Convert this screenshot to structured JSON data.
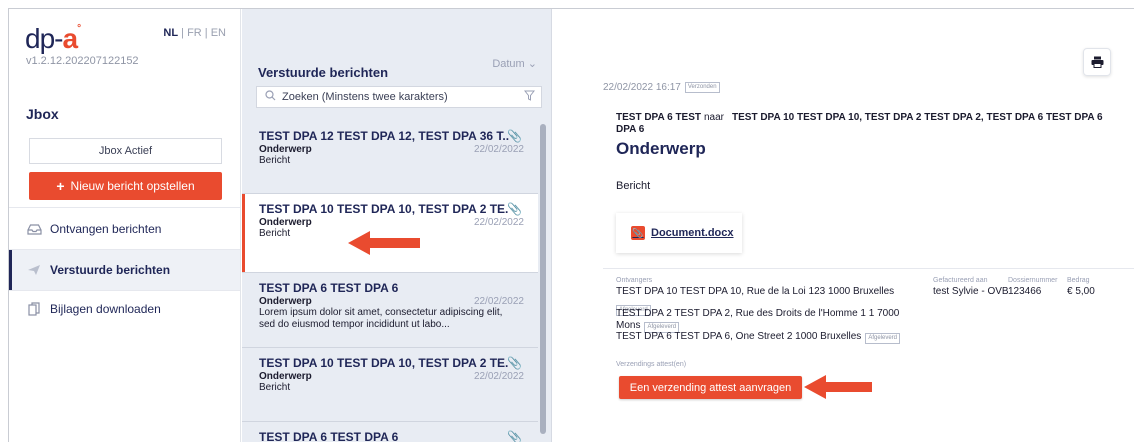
{
  "app": {
    "logo_text": "dp-a",
    "version": "v1.2.12.202207122152",
    "languages": [
      "NL",
      "FR",
      "EN"
    ],
    "active_language": "NL",
    "lang_sep": "|"
  },
  "sidebar": {
    "section_title": "Jbox",
    "jbox_status": "Jbox Actief",
    "new_message_label": "Nieuw bericht opstellen",
    "items": [
      {
        "label": "Ontvangen berichten",
        "icon": "inbox-icon",
        "active": false
      },
      {
        "label": "Verstuurde berichten",
        "icon": "send-icon",
        "active": true
      },
      {
        "label": "Bijlagen downloaden",
        "icon": "copy-icon",
        "active": false
      }
    ]
  },
  "list": {
    "title": "Verstuurde berichten",
    "sort_label": "Datum",
    "search_placeholder": "Zoeken (Minstens twee karakters)",
    "messages": [
      {
        "to": "TEST DPA 12 TEST DPA 12, TEST DPA 36 T...",
        "subject": "Onderwerp",
        "date": "22/02/2022",
        "body": "Bericht",
        "attachment": true,
        "selected": false
      },
      {
        "to": "TEST DPA 10 TEST DPA 10, TEST DPA 2 TE...",
        "subject": "Onderwerp",
        "date": "22/02/2022",
        "body": "Bericht",
        "attachment": true,
        "selected": true
      },
      {
        "to": "TEST DPA 6 TEST DPA 6",
        "subject": "Onderwerp",
        "date": "22/02/2022",
        "body": "Lorem ipsum dolor sit amet, consectetur adipiscing elit, sed do eiusmod tempor incididunt ut labo...",
        "attachment": false,
        "selected": false
      },
      {
        "to": "TEST DPA 10 TEST DPA 10, TEST DPA 2 TE...",
        "subject": "Onderwerp",
        "date": "22/02/2022",
        "body": "Bericht",
        "attachment": true,
        "selected": false
      },
      {
        "to": "TEST DPA 6 TEST DPA 6",
        "subject": "",
        "date": "",
        "body": "",
        "attachment": true,
        "selected": false
      }
    ]
  },
  "detail": {
    "datetime": "22/02/2022 16:17",
    "sent_badge": "Verzonden",
    "from": "TEST DPA 6 TEST DPA 6",
    "naar": "naar",
    "recipients": "TEST DPA 10 TEST DPA 10, TEST DPA 2 TEST DPA 2, TEST DPA 6 TEST DPA 6",
    "subject": "Onderwerp",
    "body": "Bericht",
    "attachment_name": "Document.docx",
    "columns": {
      "recipients": "Ontvangers",
      "invoiced_to": "Gefactureerd aan",
      "file_number": "Dossiernummer",
      "amount": "Bedrag"
    },
    "receivers": [
      {
        "name": "TEST DPA 10 TEST DPA 10",
        "address": ", Rue de la Loi 123 1000 Bruxelles",
        "status": "Afgeleverd"
      },
      {
        "name": "TEST DPA 2 TEST DPA 2",
        "address": ", Rue des Droits de l'Homme 1 1 7000",
        "address2": "Mons",
        "status": "Afgeleverd"
      },
      {
        "name": "TEST DPA 6 TEST DPA 6",
        "address": ", One Street 2 1000 Bruxelles",
        "status": "Afgeleverd"
      }
    ],
    "invoiced_to": "test Sylvie - OVB",
    "file_number": "123466",
    "amount": "€ 5,00",
    "attest_label": "Verzendings attest(en)",
    "attest_button": "Een verzending attest aanvragen"
  },
  "colors": {
    "accent": "#e94b2f",
    "navy": "#1f2657",
    "list_bg": "#e8ecf3"
  }
}
